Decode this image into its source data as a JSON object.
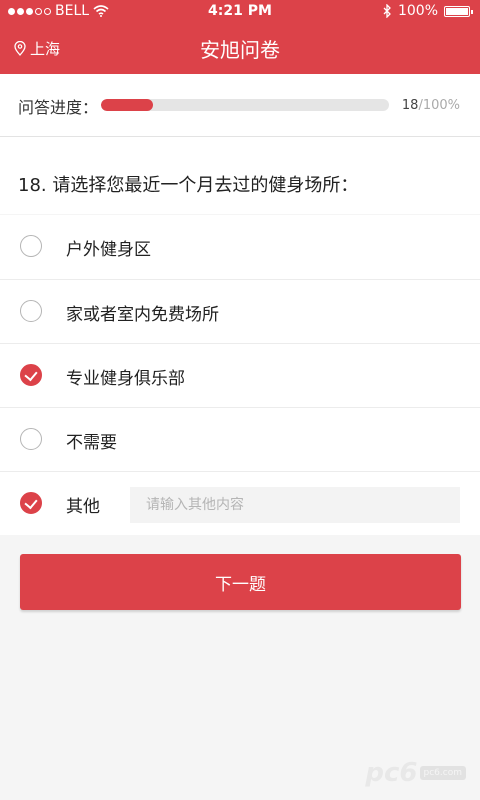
{
  "status_bar": {
    "carrier": "BELL",
    "time": "4:21 PM",
    "battery": "100%"
  },
  "nav": {
    "location": "上海",
    "title": "安旭问卷"
  },
  "progress": {
    "label": "问答进度：",
    "current": "18",
    "separator": "/",
    "total": "100%",
    "fraction": 0.18
  },
  "question": {
    "text": "18. 请选择您最近一个月去过的健身场所："
  },
  "options": [
    {
      "label": "户外健身区",
      "checked": false
    },
    {
      "label": "家或者室内免费场所",
      "checked": false
    },
    {
      "label": "专业健身俱乐部",
      "checked": true
    },
    {
      "label": "不需要",
      "checked": false
    },
    {
      "label": "其他",
      "checked": true
    }
  ],
  "other_input": {
    "placeholder": "请输入其他内容",
    "value": ""
  },
  "next_button": {
    "label": "下一题"
  },
  "watermark": {
    "text": "pc6",
    "badge": "pc6.com"
  },
  "colors": {
    "accent": "#dc4249",
    "background": "#f5f5f5"
  }
}
